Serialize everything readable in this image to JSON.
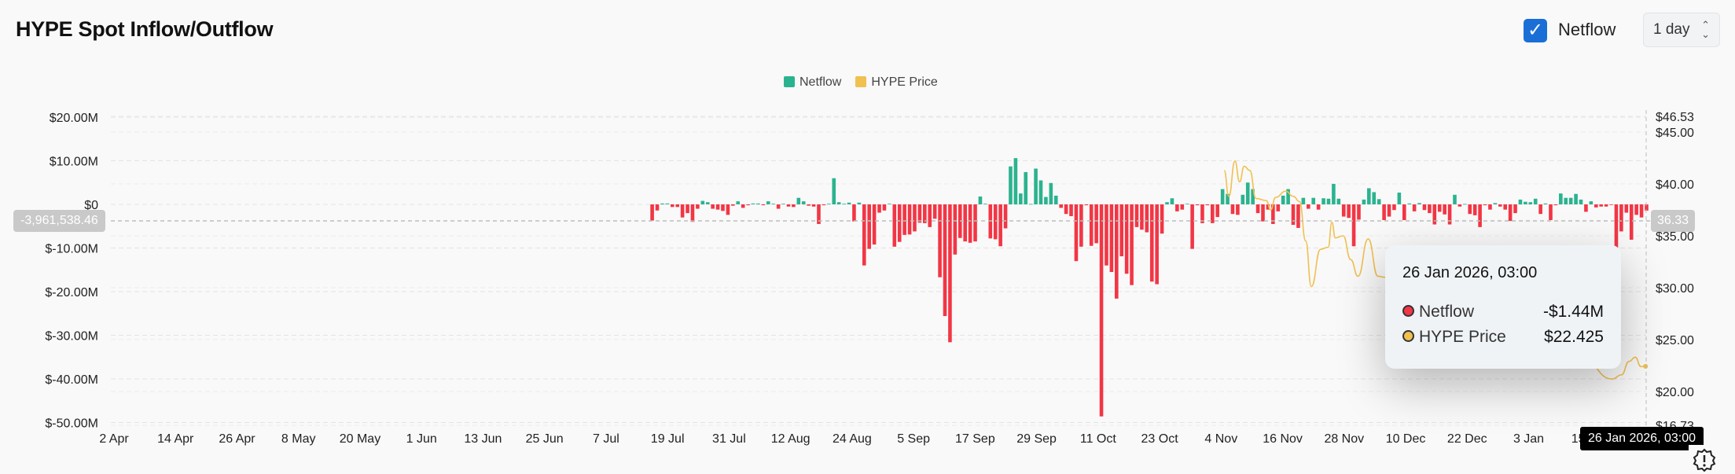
{
  "header": {
    "title": "HYPE Spot Inflow/Outflow",
    "netflow_toggle_label": "Netflow",
    "netflow_checked": true,
    "interval_value": "1 day"
  },
  "tooltip": {
    "date": "26 Jan 2026, 03:00",
    "rows": [
      {
        "label": "Netflow",
        "value": "-$1.44M",
        "color": "#f23645"
      },
      {
        "label": "HYPE Price",
        "value": "$22.425",
        "color": "#f0c050"
      }
    ]
  },
  "crosshair": {
    "left_value": "-3,961,538.46",
    "right_value": "36.33",
    "x_value": "26 Jan 2026, 03:00"
  },
  "chart_data": {
    "type": "bar",
    "title": "HYPE Spot Inflow/Outflow",
    "legend": [
      {
        "name": "Netflow",
        "color": "#2bb38f"
      },
      {
        "name": "HYPE Price",
        "color": "#f0c050"
      }
    ],
    "legend_position": "top-center",
    "colors": {
      "positive": "#2bb38f",
      "negative": "#f23645",
      "price": "#f0c050"
    },
    "y_left": {
      "ticks": [
        "$20.00M",
        "$10.00M",
        "$0",
        "$-10.00M",
        "$-20.00M",
        "$-30.00M",
        "$-40.00M",
        "$-50.00M"
      ],
      "tick_values": [
        20,
        10,
        0,
        -10,
        -20,
        -30,
        -40,
        -50
      ],
      "unit": "M USD",
      "range": [
        -50,
        23
      ]
    },
    "y_right": {
      "ticks": [
        "$46.53",
        "$45.00",
        "$40.00",
        "$35.00",
        "$30.00",
        "$25.00",
        "$20.00",
        "$16.73"
      ],
      "tick_values": [
        46.53,
        45,
        40,
        35,
        30,
        25,
        20,
        16.73
      ],
      "range": [
        16.73,
        46.53
      ]
    },
    "x_axis": {
      "ticks": [
        "2 Apr",
        "14 Apr",
        "26 Apr",
        "8 May",
        "20 May",
        "1 Jun",
        "13 Jun",
        "25 Jun",
        "7 Jul",
        "19 Jul",
        "31 Jul",
        "12 Aug",
        "24 Aug",
        "5 Sep",
        "17 Sep",
        "29 Sep",
        "11 Oct",
        "23 Oct",
        "4 Nov",
        "16 Nov",
        "28 Nov",
        "10 Dec",
        "22 Dec",
        "3 Jan",
        "15 Jan"
      ],
      "tick_days": [
        0,
        12,
        24,
        36,
        48,
        60,
        72,
        84,
        96,
        108,
        120,
        132,
        144,
        156,
        168,
        180,
        192,
        204,
        216,
        228,
        240,
        252,
        264,
        276,
        288
      ],
      "day_range": [
        0,
        299
      ],
      "day_zero": "2 Apr 2025"
    },
    "netflow_start_day": 105,
    "netflow_end_day": 299,
    "netflow_m": [
      -3.7,
      -1.4,
      0.2,
      0.2,
      -0.6,
      -0.6,
      -3,
      -2,
      -4,
      -1,
      0.8,
      0.5,
      -1,
      -1.2,
      -1.5,
      -2.4,
      -0.3,
      0.7,
      -0.8,
      -0.2,
      0.2,
      0.2,
      -0.2,
      0.7,
      0,
      -1,
      0,
      -0.5,
      -0.6,
      1.5,
      0.7,
      -0.3,
      -0.5,
      -4.5,
      -0.2,
      0,
      6,
      0.5,
      0,
      0.4,
      -3.9,
      0.4,
      -14,
      -10.2,
      -9.2,
      -1.9,
      -1.4,
      0,
      -9.7,
      -8.6,
      -7,
      -6.9,
      -6.2,
      -4.2,
      -4.3,
      -5.2,
      -3.3,
      -16.7,
      -25.6,
      -31.6,
      -11.5,
      -7.7,
      -8.5,
      -8.8,
      -8.5,
      1.8,
      0,
      -7.8,
      -8,
      -9.6,
      -5.5,
      8.7,
      10.6,
      2.5,
      7.4,
      0.1,
      8.2,
      5.5,
      1.7,
      4.9,
      2,
      -0.8,
      -2.2,
      -2.7,
      -13,
      -9.7,
      -0.2,
      -9.5,
      -8.9,
      -48.6,
      -14,
      -15.5,
      -21.6,
      -11.9,
      -15.9,
      -18.5,
      -5.2,
      -5.8,
      -6.4,
      -17.7,
      -18.3,
      -6.7,
      0.5,
      1.4,
      -1.6,
      -1.2,
      0,
      -10.2,
      -0.2,
      -4.3,
      -0.2,
      -4.3,
      -2.9,
      3.5,
      2.4,
      -2.2,
      -2.4,
      2.2,
      5,
      3.5,
      -2,
      -3.9,
      -1.2,
      -4.5,
      -1.6,
      2,
      3.5,
      -4.7,
      -5.4,
      1.5,
      -1,
      1.5,
      -1.2,
      1.4,
      1.3,
      4.7,
      1.3,
      -2.8,
      -3.1,
      -9.6,
      -3.5,
      1.1,
      3.7,
      2.8,
      1.2,
      -3.6,
      -2.8,
      -1.3,
      2.7,
      -3.6,
      0.2,
      -1.6,
      0.3,
      -1.3,
      -2,
      -4.6,
      -1.7,
      -2.3,
      -4.6,
      2.2,
      -0.5,
      0.1,
      -2.2,
      -2.5,
      -5.2,
      -0.2,
      -1.2,
      0.3,
      -0.5,
      -1.2,
      -3.8,
      -2,
      1.1,
      0.6,
      0.5,
      1.3,
      -2.2,
      0.2,
      -3.6,
      -0.2,
      2.5,
      1.5,
      1.5,
      2.4,
      1.1,
      -1.7,
      0.7,
      -0.7,
      -0.5,
      -0.5,
      -0.1,
      -10,
      -6.2,
      -1.9,
      -8.1,
      -2.4,
      -3,
      -1.44
    ],
    "price_points": [
      [
        216.6,
        41.3
      ],
      [
        217.5,
        38.8
      ],
      [
        218.7,
        42.2
      ],
      [
        219.6,
        40.2
      ],
      [
        220.5,
        41.7
      ],
      [
        221.6,
        41.3
      ],
      [
        222.8,
        38.6
      ],
      [
        224.8,
        38.4
      ],
      [
        225.7,
        37.5
      ],
      [
        226.6,
        38.7
      ],
      [
        228.6,
        39.3
      ],
      [
        230.1,
        38.8
      ],
      [
        231.3,
        38.3
      ],
      [
        232.5,
        34.5
      ],
      [
        233.6,
        30.1
      ],
      [
        235.4,
        33.7
      ],
      [
        236.9,
        33.9
      ],
      [
        237.6,
        36.3
      ],
      [
        238.3,
        34.8
      ],
      [
        239.8,
        35
      ],
      [
        241.3,
        32.7
      ],
      [
        242.7,
        31.1
      ],
      [
        244.7,
        34.7
      ],
      [
        246.6,
        31.1
      ],
      [
        248,
        31
      ],
      [
        256,
        28
      ],
      [
        266,
        26
      ],
      [
        276,
        25
      ],
      [
        286,
        23.5
      ],
      [
        292.3,
        21.2
      ],
      [
        294.1,
        21.6
      ],
      [
        295.6,
        22.9
      ],
      [
        296.8,
        23.3
      ],
      [
        297.9,
        22.4
      ],
      [
        298.8,
        22.425
      ]
    ]
  }
}
